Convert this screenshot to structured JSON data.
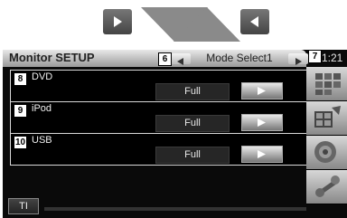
{
  "top_nav": {
    "next_icon": "play-right-icon",
    "down_icon": "triangle-down-icon",
    "up_icon": "triangle-up-icon",
    "prev_icon": "play-left-icon"
  },
  "header": {
    "title": "Monitor SETUP",
    "clock": "1:21"
  },
  "mode_selector": {
    "label": "Mode Select1",
    "callout_prev": "6",
    "callout_next": "7"
  },
  "rows": [
    {
      "callout": "8",
      "label": "DVD",
      "value": "Full"
    },
    {
      "callout": "9",
      "label": "iPod",
      "value": "Full"
    },
    {
      "callout": "10",
      "label": "USB",
      "value": "Full"
    }
  ],
  "sidebar": {
    "icons": [
      "grid-icon",
      "film-icon",
      "speaker-icon",
      "tools-icon"
    ]
  },
  "footer": {
    "ti_label": "TI"
  },
  "colors": {
    "screen_bg": "#0a0a0a",
    "title_bar": "#c8c8c8",
    "nav_triangle": "#8a8a8a"
  }
}
